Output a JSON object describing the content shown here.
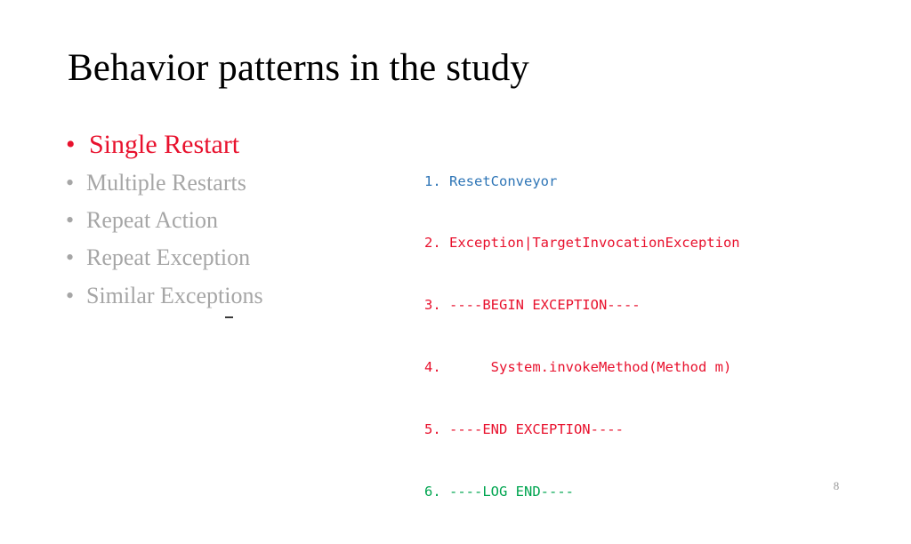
{
  "slide": {
    "title": "Behavior patterns in the study",
    "page_number": "8",
    "colors": {
      "accent_red": "#E8112D",
      "dim_gray": "#A6A6A6",
      "code_blue": "#2E75B6",
      "code_red": "#E8112D",
      "code_green": "#00A550",
      "title_black": "#000000",
      "background": "#FFFFFF"
    }
  },
  "bullets": [
    {
      "marker": "•",
      "label": "Single Restart",
      "state": "active"
    },
    {
      "marker": "•",
      "label": "Multiple Restarts",
      "state": "dim"
    },
    {
      "marker": "•",
      "label": "Repeat Action",
      "state": "dim"
    },
    {
      "marker": "•",
      "label": "Repeat Exception",
      "state": "dim"
    },
    {
      "marker": "•",
      "label": "Similar Exceptions",
      "state": "dim"
    }
  ],
  "code_listing": [
    {
      "number": "1. ",
      "text": "ResetConveyor",
      "color": "blue"
    },
    {
      "number": "2. ",
      "text": "Exception|TargetInvocationException",
      "color": "red"
    },
    {
      "number": "3. ",
      "text": "----BEGIN EXCEPTION----",
      "color": "red"
    },
    {
      "number": "4. ",
      "text": "     System.invokeMethod(Method m)",
      "color": "red"
    },
    {
      "number": "5. ",
      "text": "----END EXCEPTION----",
      "color": "red"
    },
    {
      "number": "6. ",
      "text": "----LOG END----",
      "color": "green"
    }
  ]
}
